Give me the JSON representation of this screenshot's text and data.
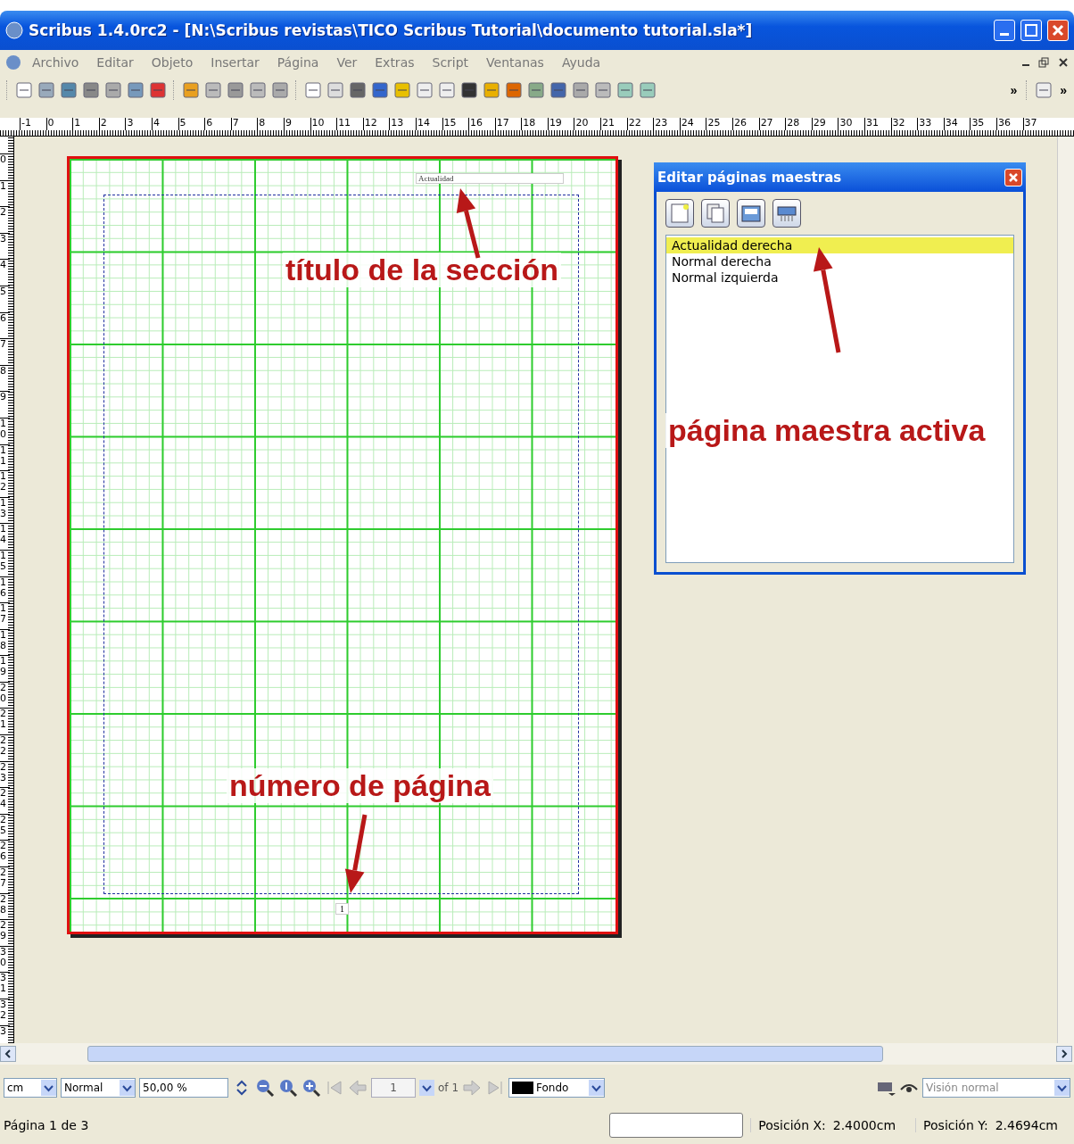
{
  "window": {
    "title": "Scribus 1.4.0rc2 - [N:\\Scribus revistas\\TICO Scribus Tutorial\\documento tutorial.sla*]"
  },
  "menu": {
    "items": [
      "Archivo",
      "Editar",
      "Objeto",
      "Insertar",
      "Página",
      "Ver",
      "Extras",
      "Script",
      "Ventanas",
      "Ayuda"
    ]
  },
  "toolbar": {
    "overflow": [
      "»",
      "»"
    ]
  },
  "rulers": {
    "horizontal": [
      "-1",
      "0",
      "1",
      "2",
      "3",
      "4",
      "5",
      "6",
      "7",
      "8",
      "9",
      "10",
      "11",
      "12",
      "13",
      "14",
      "15",
      "16",
      "17",
      "18",
      "19",
      "20",
      "21",
      "22",
      "23",
      "24",
      "25",
      "26",
      "27",
      "28",
      "29",
      "30",
      "31",
      "32",
      "33",
      "34",
      "35",
      "36",
      "37"
    ],
    "vertical": [
      "0",
      "1",
      "2",
      "3",
      "4",
      "5",
      "6",
      "7",
      "8",
      "9",
      "10",
      "11",
      "12",
      "13",
      "14",
      "15",
      "16",
      "17",
      "18",
      "19",
      "20",
      "21",
      "22",
      "23",
      "24",
      "25",
      "26",
      "27",
      "28",
      "29",
      "30",
      "31",
      "32",
      "3"
    ]
  },
  "page": {
    "header_text": "Actualidad",
    "page_number": "1"
  },
  "annotations": [
    {
      "text": "título de la sección"
    },
    {
      "text": "número de página"
    },
    {
      "text": "página maestra activa"
    }
  ],
  "dialog": {
    "title": "Editar páginas maestras",
    "items": [
      {
        "label": "Actualidad derecha",
        "selected": true
      },
      {
        "label": "Normal derecha",
        "selected": false
      },
      {
        "label": "Normal izquierda",
        "selected": false
      }
    ]
  },
  "bottom_toolbar": {
    "unit": "cm",
    "mode": "Normal",
    "zoom": "50,00 %",
    "page_field": "1",
    "page_of": "of 1",
    "layer": "Fondo",
    "view": "Visión normal"
  },
  "status_bar": {
    "page": "Página 1 de 3",
    "pos_x_label": "Posición X:",
    "pos_x": "2.4000cm",
    "pos_y_label": "Posición Y:",
    "pos_y": "2.4694cm"
  }
}
